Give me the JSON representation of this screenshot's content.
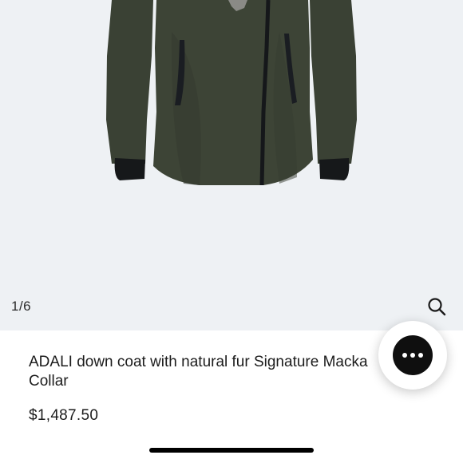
{
  "gallery": {
    "counter": "1/6",
    "image_alt": "ADALI down coat in olive green",
    "zoom_icon": "search-icon",
    "background_color": "#eef1f4",
    "coat_color": "#3d4436"
  },
  "product": {
    "title_line1": "ADALI down coat with natural fur Signature Macka",
    "title_line2": "Collar",
    "price": "$1,487.50"
  },
  "chat": {
    "icon": "chat-ellipsis-icon"
  }
}
